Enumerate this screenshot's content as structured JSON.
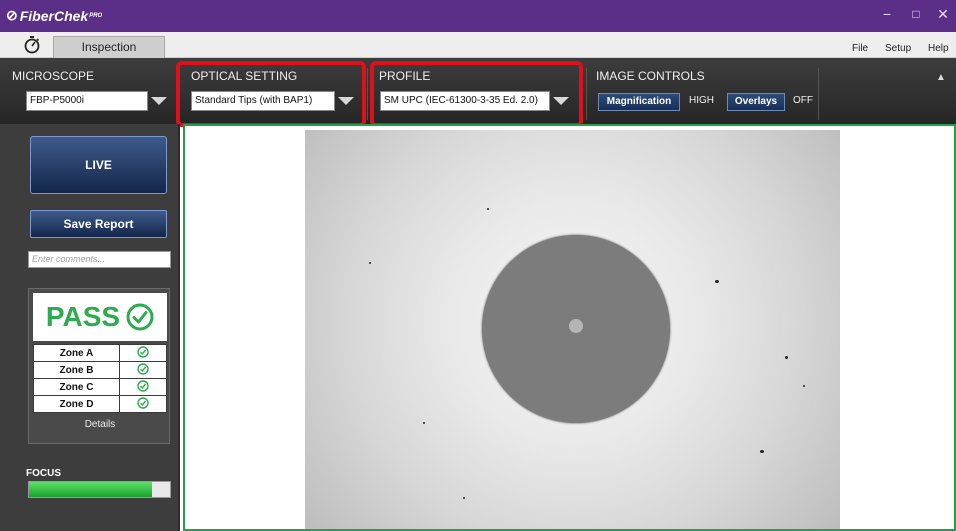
{
  "app": {
    "title": "FiberChek",
    "title_suffix": "PRO",
    "window_controls": {
      "minimize": "−",
      "maximize": "□",
      "close": "✕"
    }
  },
  "tabs": [
    {
      "label": "Inspection",
      "active": true
    }
  ],
  "menu": [
    "File",
    "Setup",
    "Help"
  ],
  "toolbar": {
    "microscope": {
      "label": "MICROSCOPE",
      "value": "FBP-P5000i"
    },
    "optical_setting": {
      "label": "OPTICAL SETTING",
      "value": "Standard Tips (with BAP1)",
      "highlighted": true
    },
    "profile": {
      "label": "PROFILE",
      "value": "SM UPC (IEC-61300-3-35 Ed. 2.0)",
      "highlighted": true
    },
    "image_controls": {
      "label": "IMAGE CONTROLS",
      "magnification_button": "Magnification",
      "magnification_state": "HIGH",
      "overlays_button": "Overlays",
      "overlays_state": "OFF"
    }
  },
  "left_panel": {
    "live_button": "LIVE",
    "save_report_button": "Save Report",
    "comments_placeholder": "Enter comments...",
    "result": {
      "status": "PASS",
      "zones": [
        {
          "name": "Zone A",
          "result": "pass"
        },
        {
          "name": "Zone B",
          "result": "pass"
        },
        {
          "name": "Zone C",
          "result": "pass"
        },
        {
          "name": "Zone D",
          "result": "pass"
        }
      ],
      "details_link": "Details"
    },
    "focus": {
      "label": "FOCUS",
      "level": 0.87
    }
  },
  "colors": {
    "title_bar": "#5b2f87",
    "pass_green": "#2dab4f",
    "highlight_red": "#e0101a",
    "view_border": "#22a04a",
    "button_blue": "#1a2f55"
  },
  "icons": {
    "app_logo": "fiberchek-logo-icon",
    "stopwatch": "stopwatch-icon",
    "dropdown": "chevron-down-icon",
    "pass": "check-circle-icon",
    "collapse": "chevron-up-icon"
  }
}
